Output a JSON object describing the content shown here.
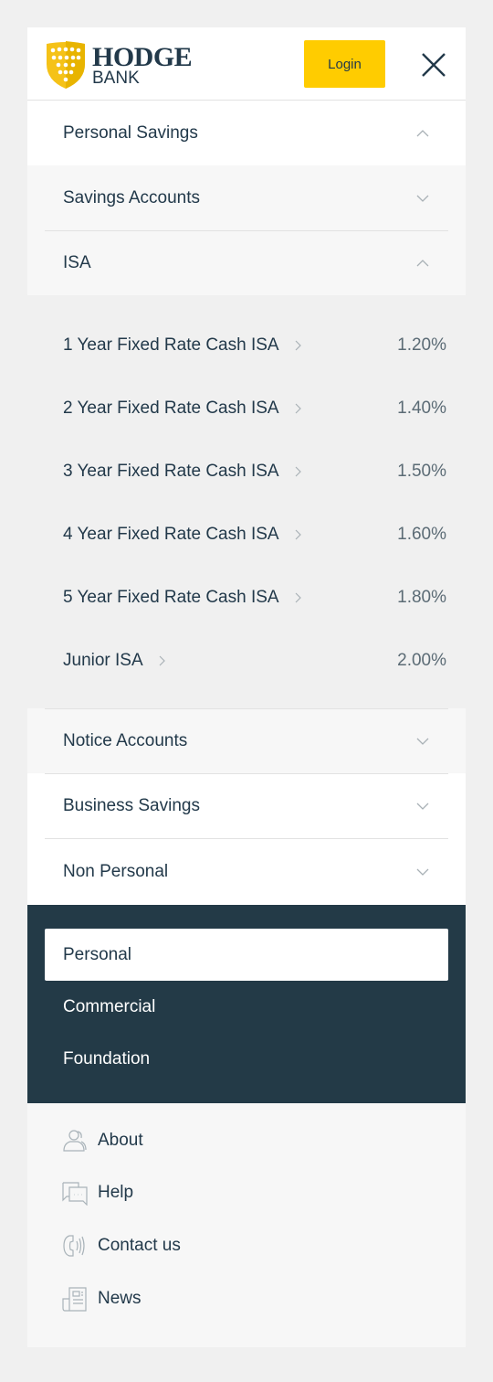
{
  "header": {
    "logo_top": "HODGE",
    "logo_bottom": "BANK",
    "login_label": "Login",
    "brand_color": "#ffcc00"
  },
  "menu": {
    "personal_savings": "Personal Savings",
    "savings_accounts": "Savings Accounts",
    "isa": "ISA",
    "isa_items": [
      {
        "label": "1 Year Fixed Rate Cash ISA",
        "rate": "1.20%"
      },
      {
        "label": "2 Year Fixed Rate Cash ISA",
        "rate": "1.40%"
      },
      {
        "label": "3 Year Fixed Rate Cash ISA",
        "rate": "1.50%"
      },
      {
        "label": "4 Year Fixed Rate Cash ISA",
        "rate": "1.60%"
      },
      {
        "label": "5 Year Fixed Rate Cash ISA",
        "rate": "1.80%"
      },
      {
        "label": "Junior ISA",
        "rate": "2.00%"
      }
    ],
    "notice_accounts": "Notice Accounts",
    "business_savings": "Business Savings",
    "non_personal": "Non Personal"
  },
  "segments": {
    "items": [
      "Personal",
      "Commercial",
      "Foundation"
    ],
    "active": "Personal",
    "bg": "#233a47"
  },
  "footer": {
    "items": [
      {
        "label": "About",
        "icon": "person-icon"
      },
      {
        "label": "Help",
        "icon": "chat-icon"
      },
      {
        "label": "Contact us",
        "icon": "phone-icon"
      },
      {
        "label": "News",
        "icon": "newspaper-icon"
      }
    ]
  }
}
